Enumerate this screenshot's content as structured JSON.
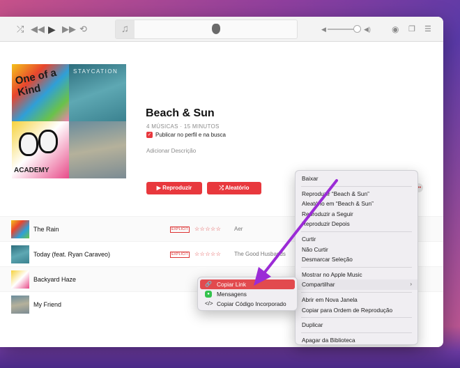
{
  "playlist": {
    "title": "Beach & Sun",
    "meta": "4 MÚSICAS · 15 MINUTOS",
    "publish_label": "Publicar no perfil e na busca",
    "add_description": "Adicionar Descrição",
    "play_label": "Reproduzir",
    "shuffle_label": "Aleatório",
    "cover_texts": [
      "One of a Kind",
      "STAYCATION",
      "ACADEMY"
    ]
  },
  "tracks": [
    {
      "name": "The Rain",
      "explicit": "EXPLICIT",
      "stars": "☆☆☆☆☆",
      "artist": "Aer"
    },
    {
      "name": "Today (feat. Ryan Caraveo)",
      "explicit": "EXPLICIT",
      "stars": "☆☆☆☆☆",
      "artist": "The Good Husbands"
    },
    {
      "name": "Backyard Haze",
      "explicit": "",
      "stars": "",
      "artist": ""
    },
    {
      "name": "My Friend",
      "explicit": "",
      "stars": "",
      "artist": ""
    }
  ],
  "context_menu": {
    "items": [
      "Baixar",
      "Reproduzir “Beach & Sun”",
      "Aleatório em “Beach & Sun”",
      "Reproduzir a Seguir",
      "Reproduzir Depois",
      "Curtir",
      "Não Curtir",
      "Desmarcar Seleção",
      "Mostrar no Apple Music",
      "Compartilhar",
      "Abrir em Nova Janela",
      "Copiar para Ordem de Reprodução",
      "Duplicar",
      "Apagar da Biblioteca"
    ]
  },
  "share_submenu": {
    "items": [
      "Copiar Link",
      "Mensagens",
      "Copiar Código Incorporado"
    ]
  },
  "colors": {
    "accent": "#e8383d",
    "highlight": "#e24a4e",
    "annotation_arrow": "#9b2bd6"
  },
  "icons": {
    "shuffle": "shuffle-icon",
    "previous": "previous-icon",
    "play": "play-icon",
    "next": "next-icon",
    "repeat": "repeat-icon",
    "airplay": "airplay-icon",
    "lyrics": "lyrics-icon",
    "queue": "queue-icon"
  }
}
